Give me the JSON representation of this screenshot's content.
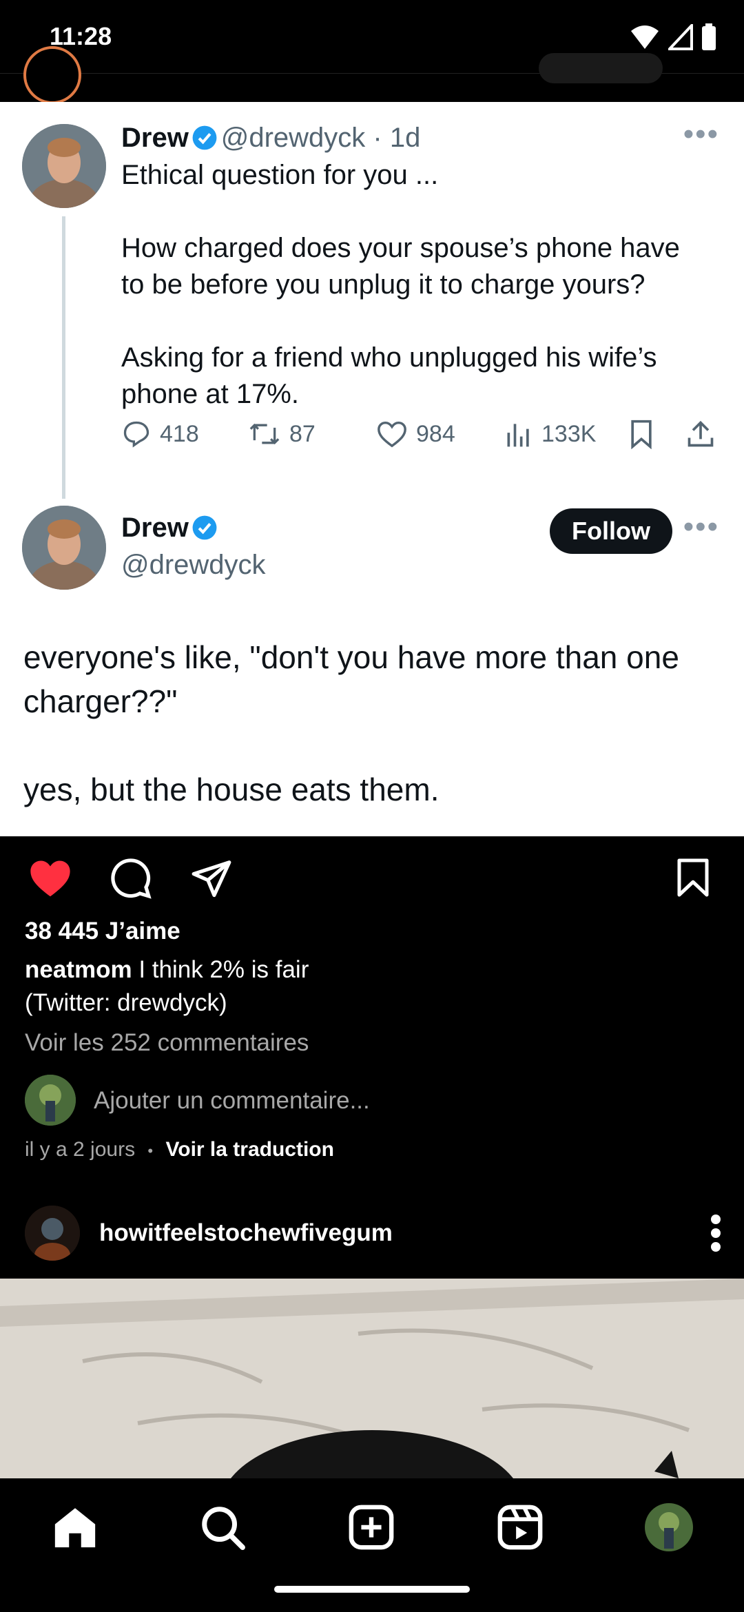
{
  "status_bar": {
    "time": "11:28"
  },
  "tweet": {
    "author_name": "Drew",
    "handle_time": "@drewdyck · 1d",
    "lines": [
      "Ethical question for you ...",
      "",
      "How charged does your spouse’s phone have",
      "to be before you unplug it to charge yours?",
      "",
      "Asking for a friend who unplugged his wife’s",
      "phone at 17%."
    ],
    "stats": {
      "replies": "418",
      "retweets": "87",
      "likes": "984",
      "views": "133K"
    }
  },
  "reply": {
    "author_name": "Drew",
    "handle": "@drewdyck",
    "follow_label": "Follow",
    "line1": "everyone's like, \"don't you have more than one",
    "line2": "charger??\"",
    "line3": "yes, but the house eats them."
  },
  "post": {
    "likes": "38 445 J’aime",
    "caption_user": "neatmom",
    "caption_text": "I think 2% is fair",
    "caption_line2": "(Twitter: drewdyck)",
    "view_comments": "Voir les 252 commentaires",
    "add_comment_placeholder": "Ajouter un commentaire...",
    "time_ago": "il y a 2 jours",
    "separator": "•",
    "translate": "Voir la traduction"
  },
  "next_post": {
    "username": "howitfeelstochewfivegum"
  },
  "colors": {
    "like_red": "#ff3040",
    "verified_blue": "#1d9bf0",
    "dark": "#0f1419",
    "muted": "#536471"
  },
  "icons": [
    "heart-icon",
    "comment-icon",
    "share-icon",
    "bookmark-icon",
    "home-icon",
    "search-icon",
    "create-icon",
    "reels-icon"
  ]
}
